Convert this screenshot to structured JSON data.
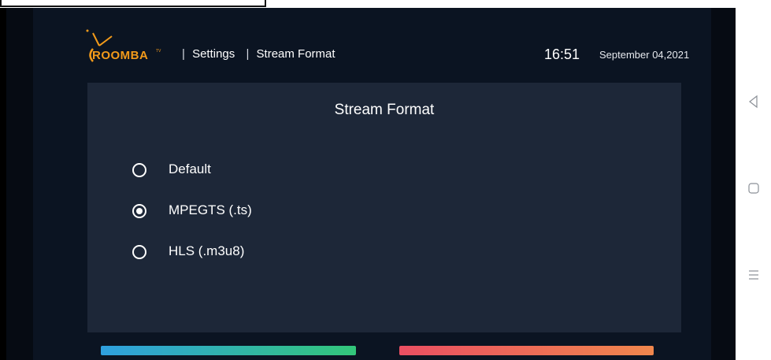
{
  "app": {
    "logo_text": "ROOMBA",
    "logo_tm": "TV"
  },
  "header": {
    "breadcrumb": {
      "separator": "|",
      "items": [
        "Settings",
        "Stream Format"
      ]
    },
    "time": "16:51",
    "date": "September 04,2021"
  },
  "panel": {
    "title": "Stream Format",
    "options": [
      {
        "label": "Default",
        "checked": false
      },
      {
        "label": "MPEGTS (.ts)",
        "checked": true
      },
      {
        "label": "HLS (.m3u8)",
        "checked": false
      }
    ]
  },
  "system_nav": {
    "icons": [
      "back-icon",
      "home-icon",
      "menu-icon"
    ]
  },
  "colors": {
    "background": "#0b1422",
    "panel": "#1d2738",
    "brand": "#f29a1a",
    "save_gradient": [
      "#2fa0df",
      "#33c77a"
    ],
    "cancel_gradient": [
      "#ea4f62",
      "#f0874d"
    ]
  }
}
